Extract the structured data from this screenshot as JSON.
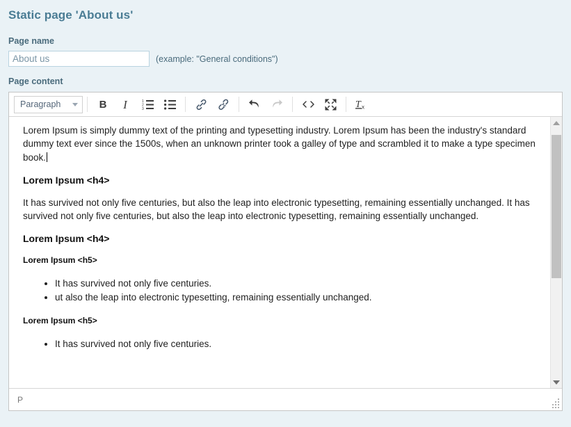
{
  "page": {
    "title": "Static page 'About us'"
  },
  "form": {
    "page_name_label": "Page name",
    "page_name_value": "About us",
    "page_name_placeholder": "About us",
    "page_name_hint": "(example: \"General conditions\")",
    "page_content_label": "Page content"
  },
  "editor": {
    "toolbar": {
      "format_select": "Paragraph",
      "buttons": [
        {
          "name": "bold",
          "label": "B"
        },
        {
          "name": "italic",
          "label": "I"
        },
        {
          "name": "numbered-list",
          "label": "Numbered list"
        },
        {
          "name": "bulleted-list",
          "label": "Bulleted list"
        },
        {
          "name": "link",
          "label": "Insert/edit link"
        },
        {
          "name": "unlink",
          "label": "Remove link"
        },
        {
          "name": "undo",
          "label": "Undo"
        },
        {
          "name": "redo",
          "label": "Redo"
        },
        {
          "name": "source-code",
          "label": "Source code"
        },
        {
          "name": "fullscreen",
          "label": "Fullscreen"
        },
        {
          "name": "remove-format",
          "label": "Clear formatting"
        }
      ]
    },
    "content": {
      "p1": "Lorem Ipsum is simply dummy text of the printing and typesetting industry. Lorem Ipsum has been the industry's standard dummy text ever since the 1500s, when an unknown printer took a galley of type and scrambled it to make a type specimen book.",
      "h4_1": "Lorem Ipsum <h4>",
      "p2": "It has survived not only five centuries, but also the leap into electronic typesetting, remaining essentially unchanged. It has survived not only five centuries, but also the leap into electronic typesetting, remaining essentially unchanged.",
      "h4_2": "Lorem Ipsum <h4>",
      "h5_1": "Lorem Ipsum <h5>",
      "list1": [
        "It has survived not only five centuries.",
        "ut also the leap into electronic typesetting, remaining essentially unchanged."
      ],
      "h5_2": "Lorem Ipsum <h5>",
      "list2": [
        "It has survived not only five centuries."
      ]
    },
    "statusbar": {
      "element_path": "P"
    }
  },
  "colors": {
    "page_background": "#eaf2f6",
    "title": "#4a7c94",
    "label": "#4a6b7c",
    "input_border": "#b9d3e0",
    "editor_border": "#c5c5c5"
  }
}
